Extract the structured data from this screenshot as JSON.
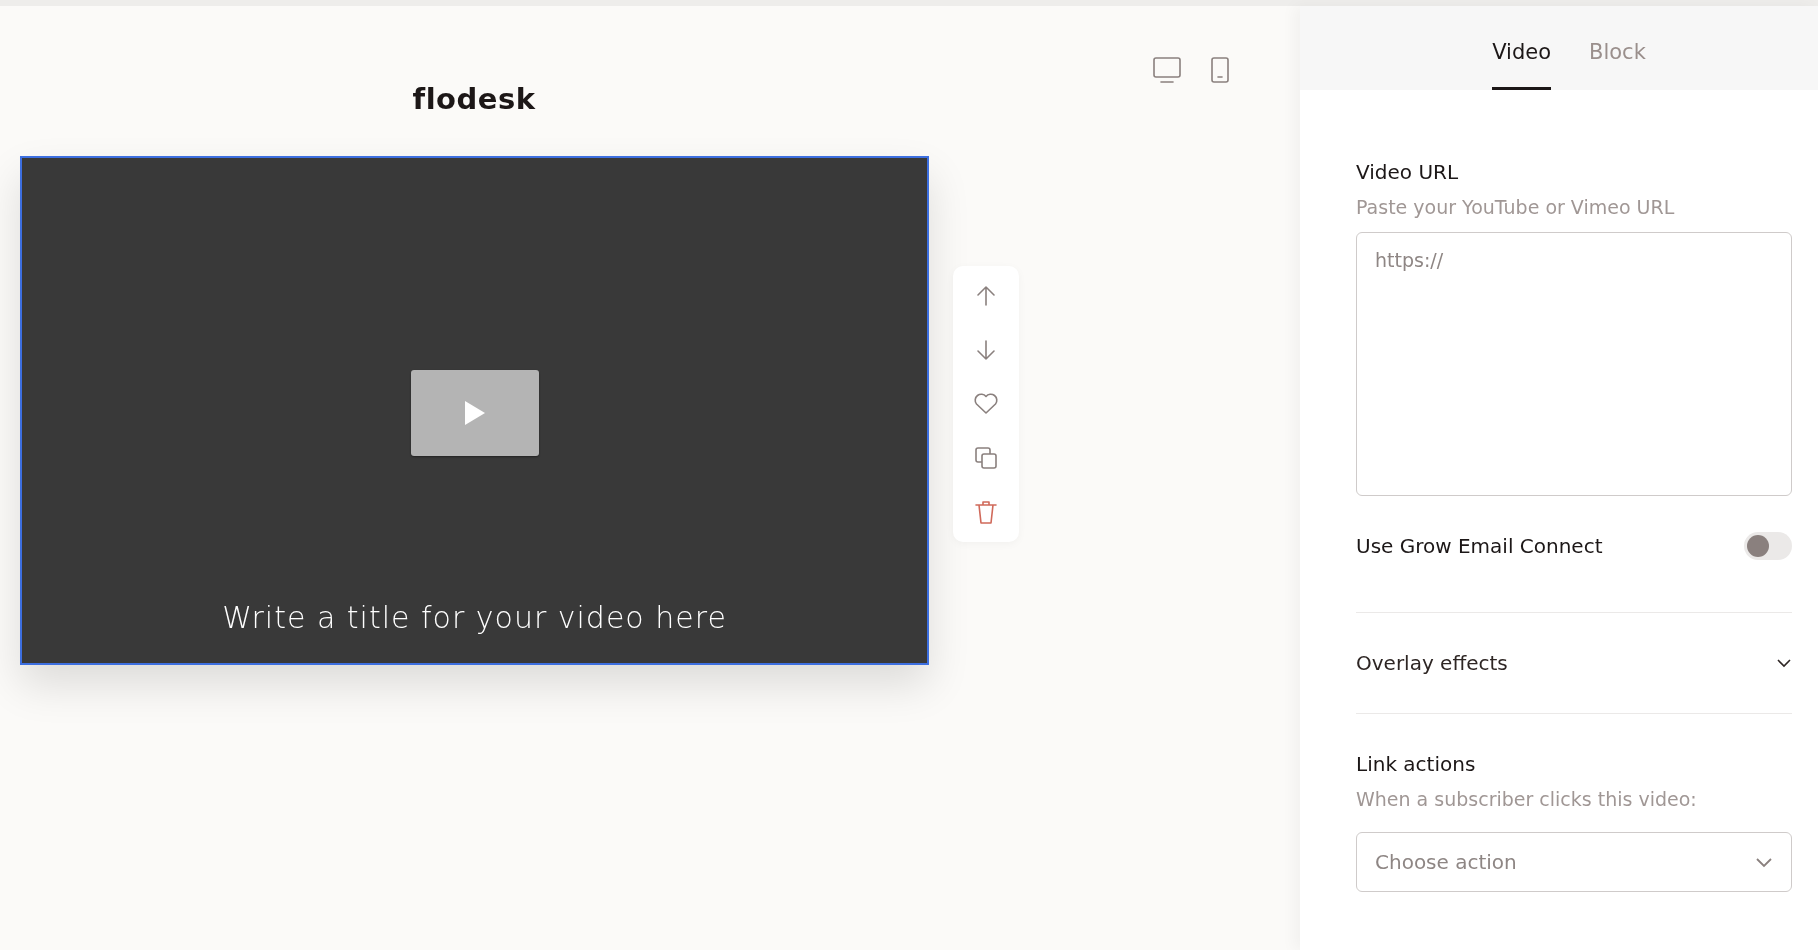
{
  "canvas": {
    "logo": "flodesk",
    "video": {
      "title": "Write a title for your video here",
      "selected": true
    }
  },
  "block_toolbar": [
    {
      "kind": "up"
    },
    {
      "kind": "down"
    },
    {
      "kind": "favorite"
    },
    {
      "kind": "duplicate"
    },
    {
      "kind": "delete"
    }
  ],
  "panel": {
    "tabs": [
      {
        "label": "Video",
        "selected": true
      },
      {
        "label": "Block",
        "selected": false
      }
    ],
    "video_url": {
      "label": "Video URL",
      "hint": "Paste your YouTube or Vimeo URL",
      "placeholder": "https://"
    },
    "grow_email_connect": {
      "label": "Use Grow Email Connect",
      "on": false
    },
    "overlay_effects": {
      "label": "Overlay effects",
      "expanded": false
    },
    "link_actions": {
      "label": "Link actions",
      "hint": "When a subscriber clicks this video:",
      "placeholder": "Choose action"
    }
  }
}
